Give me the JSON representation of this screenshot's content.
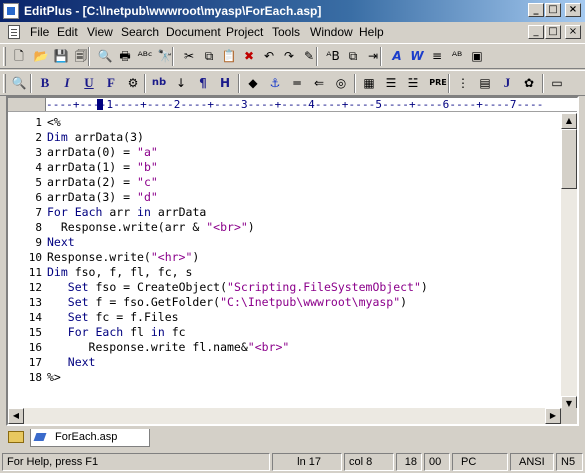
{
  "window": {
    "title": "EditPlus - [C:\\Inetpub\\wwwroot\\myasp\\ForEach.asp]",
    "min_glyph": "_",
    "max_glyph": "□",
    "close_glyph": "×"
  },
  "menu": {
    "items": [
      "File",
      "Edit",
      "View",
      "Search",
      "Document",
      "Project",
      "Tools",
      "Window",
      "Help"
    ]
  },
  "toolbar1": {
    "icons": [
      "new-file-icon",
      "open-folder-icon",
      "save-icon",
      "save-all-icon",
      "print-preview-icon",
      "print-icon",
      "spellcheck-icon",
      "find-icon",
      "cut-icon",
      "copy-icon",
      "paste-icon",
      "delete-icon",
      "undo-icon",
      "redo-icon",
      "highlight-icon",
      "replace-icon",
      "clipboard-icon",
      "indent-icon",
      "font-icon",
      "wordwrap-icon",
      "column-ruler-icon",
      "line-number-icon",
      "screen-icon"
    ],
    "glyphs": [
      "🗋",
      "📂",
      "💾",
      "🗐",
      "🔍",
      "🖶",
      "ᴬᴮᶜ",
      "🔭",
      "✂",
      "⧉",
      "📋",
      "✖",
      "↶",
      "↷",
      "✎",
      "ᴬB",
      "⧉",
      "⇥",
      "A",
      "W",
      "≡",
      "ᴬᴮ",
      "▣"
    ]
  },
  "toolbar2": {
    "glyphs": [
      "🔍",
      "B",
      "I",
      "U",
      "F",
      "⚙",
      "nb",
      "↓",
      "¶",
      "H",
      "◆",
      "⚓",
      "═",
      "⇐",
      "◎",
      "▦",
      "☰",
      "☱",
      "PRE",
      "⋮",
      "▤",
      "J",
      "✿",
      "▭"
    ],
    "icons": [
      "preview-icon",
      "bold-icon",
      "italic-icon",
      "underline-icon",
      "font-tag-icon",
      "color-icon",
      "nbsp-icon",
      "break-icon",
      "paragraph-icon",
      "heading-icon",
      "image-icon",
      "anchor-icon",
      "hr-icon",
      "comment-icon",
      "center-icon",
      "table-icon",
      "list-icon",
      "list2-icon",
      "pre-icon",
      "dots-icon",
      "form-icon",
      "javascript-icon",
      "flower-icon",
      "frame-icon"
    ]
  },
  "ruler": {
    "text": "----+----1----+----2----+----3----+----4----+----5----+----6----+----7----"
  },
  "code": {
    "lines": [
      {
        "n": "1",
        "text": "<%"
      },
      {
        "n": "2",
        "text": "Dim arrData(3)"
      },
      {
        "n": "3",
        "text": "arrData(0) = \"a\""
      },
      {
        "n": "4",
        "text": "arrData(1) = \"b\""
      },
      {
        "n": "5",
        "text": "arrData(2) = \"c\""
      },
      {
        "n": "6",
        "text": "arrData(3) = \"d\""
      },
      {
        "n": "7",
        "text": "For Each arr in arrData"
      },
      {
        "n": "8",
        "text": "  Response.write(arr & \"<br>\")"
      },
      {
        "n": "9",
        "text": "Next"
      },
      {
        "n": "10",
        "text": "Response.write(\"<hr>\")"
      },
      {
        "n": "11",
        "text": "Dim fso, f, fl, fc, s"
      },
      {
        "n": "12",
        "text": "   Set fso = CreateObject(\"Scripting.FileSystemObject\")"
      },
      {
        "n": "13",
        "text": "   Set f = fso.GetFolder(\"C:\\Inetpub\\wwwroot\\myasp\")"
      },
      {
        "n": "14",
        "text": "   Set fc = f.Files"
      },
      {
        "n": "15",
        "text": "   For Each fl in fc"
      },
      {
        "n": "16",
        "text": "      Response.write fl.name&\"<br>\""
      },
      {
        "n": "17",
        "text": "   Next"
      },
      {
        "n": "18",
        "text": "%>"
      }
    ]
  },
  "tabs": [
    {
      "label": "ForEach.asp"
    }
  ],
  "status": {
    "help": "For Help, press F1",
    "line": "ln 17",
    "col": "col 8",
    "num1": "18",
    "num2": "00",
    "mode": "PC",
    "encoding": "ANSI",
    "extra": "N5"
  },
  "colors": {
    "keyword": "#000080",
    "string": "#8b008b",
    "titlebar_start": "#0a246a",
    "titlebar_end": "#a6caf0"
  }
}
